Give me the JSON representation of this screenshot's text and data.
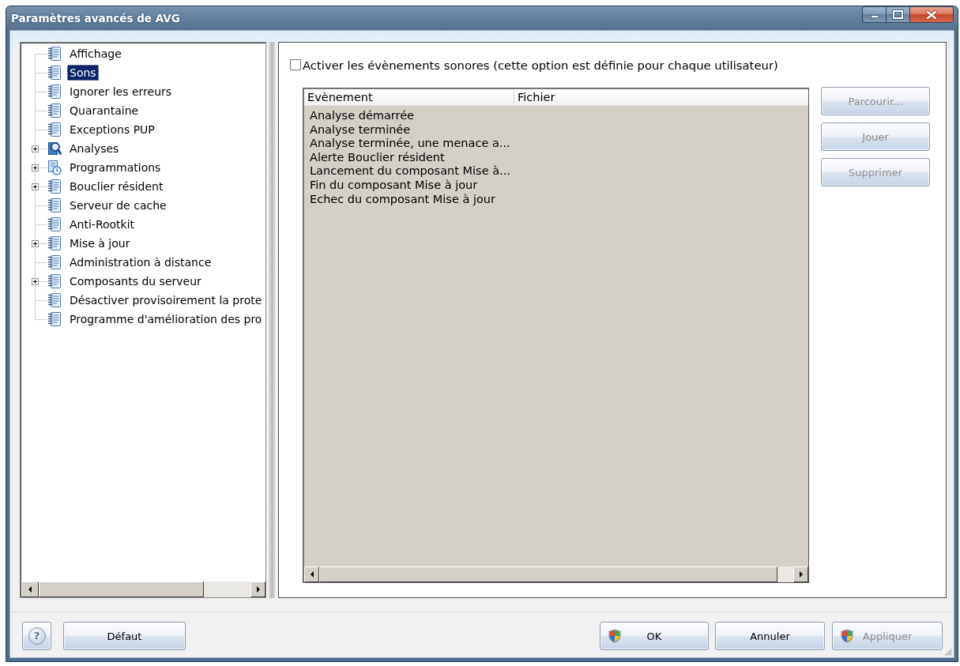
{
  "window": {
    "title": "Paramètres avancés de AVG"
  },
  "tree": {
    "items": [
      {
        "label": "Affichage",
        "kind": "page",
        "selected": false
      },
      {
        "label": "Sons",
        "kind": "page",
        "selected": true
      },
      {
        "label": "Ignorer les erreurs",
        "kind": "page",
        "selected": false
      },
      {
        "label": "Quarantaine",
        "kind": "page",
        "selected": false
      },
      {
        "label": "Exceptions PUP",
        "kind": "page",
        "selected": false
      },
      {
        "label": "Analyses",
        "kind": "scan",
        "selected": false,
        "expanded": false
      },
      {
        "label": "Programmations",
        "kind": "schedule",
        "selected": false,
        "expanded": false
      },
      {
        "label": "Bouclier résident",
        "kind": "page",
        "selected": false,
        "expanded": false
      },
      {
        "label": "Serveur de cache",
        "kind": "page",
        "selected": false
      },
      {
        "label": "Anti-Rootkit",
        "kind": "page",
        "selected": false
      },
      {
        "label": "Mise à jour",
        "kind": "page",
        "selected": false,
        "expanded": false
      },
      {
        "label": "Administration à distance",
        "kind": "page",
        "selected": false
      },
      {
        "label": "Composants du serveur",
        "kind": "page",
        "selected": false,
        "expanded": false
      },
      {
        "label": "Désactiver provisoirement la prote",
        "kind": "page",
        "selected": false
      },
      {
        "label": "Programme d'amélioration des pro",
        "kind": "page",
        "selected": false
      }
    ]
  },
  "sound_option": {
    "label": "Activer les évènements sonores (cette option est définie pour chaque utilisateur)",
    "checked": false
  },
  "events_list": {
    "disabled": true,
    "columns": [
      "Evènement",
      "Fichier"
    ],
    "rows": [
      [
        "Analyse démarrée"
      ],
      [
        "Analyse terminée"
      ],
      [
        "Analyse terminée, une menace a..."
      ],
      [
        "Alerte Bouclier résident"
      ],
      [
        "Lancement du composant Mise à..."
      ],
      [
        "Fin du composant Mise à jour"
      ],
      [
        "Echec du composant Mise à jour"
      ]
    ]
  },
  "side_buttons": [
    {
      "label": "Parcourir...",
      "disabled": true
    },
    {
      "label": "Jouer",
      "disabled": true
    },
    {
      "label": "Supprimer",
      "disabled": true
    }
  ],
  "footer": {
    "help": "?",
    "default_button": {
      "label": "Défaut",
      "disabled": false
    },
    "buttons": [
      {
        "label": "OK",
        "kind": "elevated",
        "disabled": false
      },
      {
        "label": "Annuler",
        "kind": "plain",
        "disabled": false
      },
      {
        "label": "Appliquer",
        "kind": "elevated",
        "disabled": true
      }
    ]
  }
}
